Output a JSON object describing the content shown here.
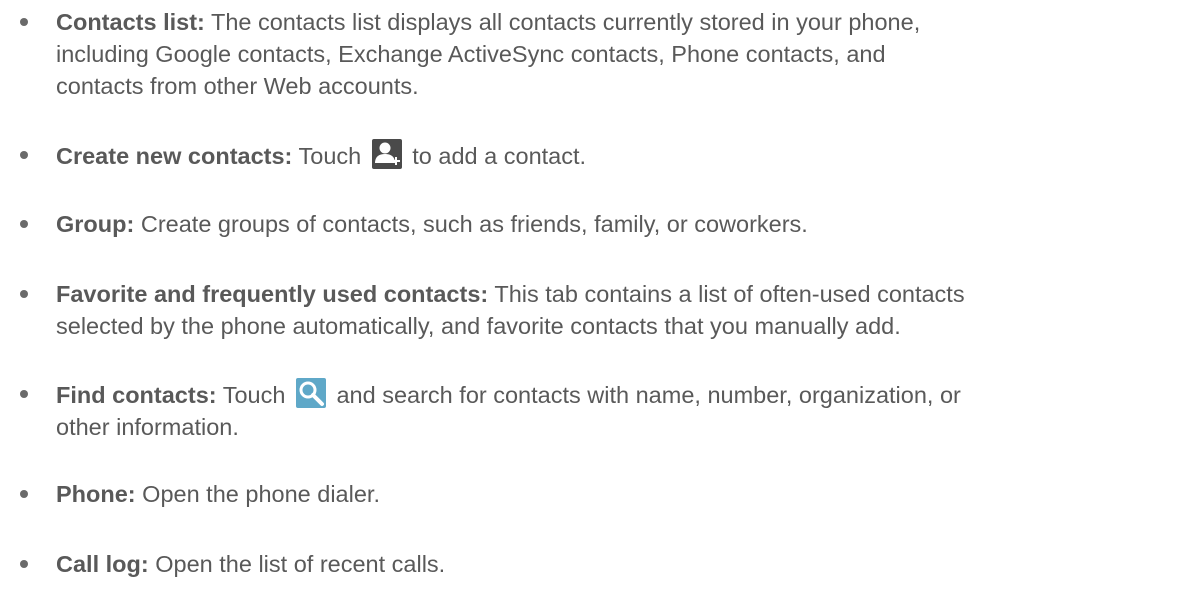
{
  "items": [
    {
      "term": "Contacts list:",
      "line1": " The contacts list displays all contacts currently stored in your phone,",
      "line2": "including Google contacts, Exchange ActiveSync contacts, Phone contacts, and",
      "line3": "contacts from other Web accounts."
    },
    {
      "term": "Create new contacts:",
      "before_icon": " Touch",
      "icon": "add-contact-icon",
      "after_icon": "to add a contact."
    },
    {
      "term": "Group:",
      "line1": " Create groups of contacts, such as friends, family, or coworkers."
    },
    {
      "term": "Favorite and frequently used contacts:",
      "line1": " This tab contains a list of often-used contacts",
      "line2": "selected by the phone automatically, and favorite contacts that you manually add."
    },
    {
      "term": "Find contacts:",
      "before_icon": " Touch",
      "icon": "search-icon",
      "after_icon": "and search for contacts with name, number, organization, or",
      "line2": "other information."
    },
    {
      "term": "Phone:",
      "line1": " Open the phone dialer."
    },
    {
      "term": "Call log:",
      "line1": " Open the list of recent calls."
    }
  ],
  "colors": {
    "text": "#595959",
    "icon_background": "#4a4a4a",
    "icon_foreground": "#ffffff",
    "search_icon_background": "#5fa8c8"
  }
}
